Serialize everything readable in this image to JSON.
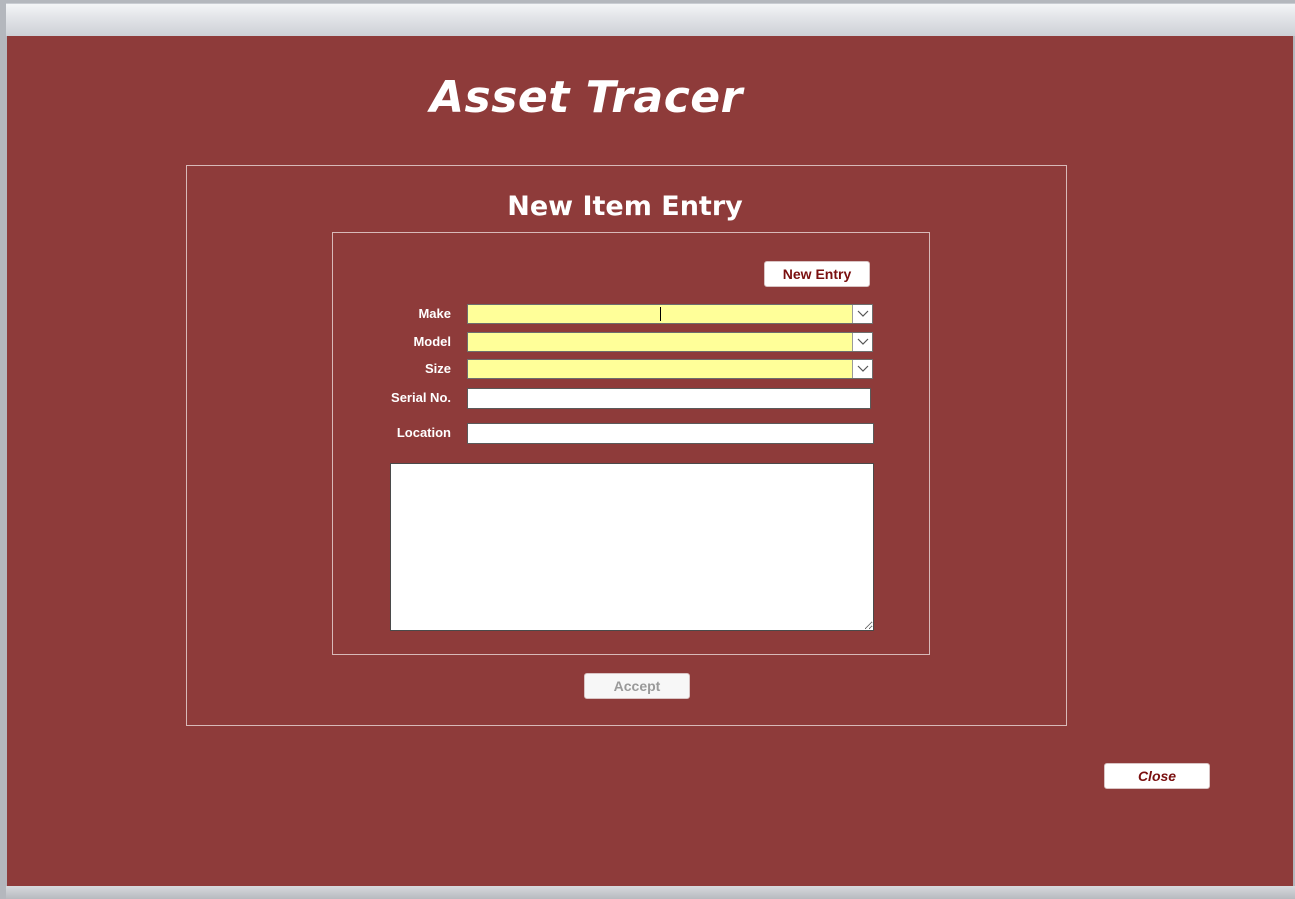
{
  "app": {
    "title": "Asset Tracer"
  },
  "form": {
    "title": "New Item Entry",
    "new_entry_label": "New Entry",
    "accept_label": "Accept",
    "accept_enabled": false,
    "fields": {
      "make": {
        "label": "Make",
        "value": "",
        "type": "combo"
      },
      "model": {
        "label": "Model",
        "value": "",
        "type": "combo"
      },
      "size": {
        "label": "Size",
        "value": "",
        "type": "combo"
      },
      "serial": {
        "label": "Serial No.",
        "value": ""
      },
      "location": {
        "label": "Location",
        "value": ""
      },
      "notes": {
        "value": ""
      }
    }
  },
  "footer": {
    "close_label": "Close"
  },
  "icons": {
    "combo_arrow": "chevron-down-icon"
  },
  "colors": {
    "background": "#8e3b3a",
    "combo_fill": "#ffff99",
    "button_text": "#7a0f0f",
    "panel_border": "#d8b9b8"
  }
}
